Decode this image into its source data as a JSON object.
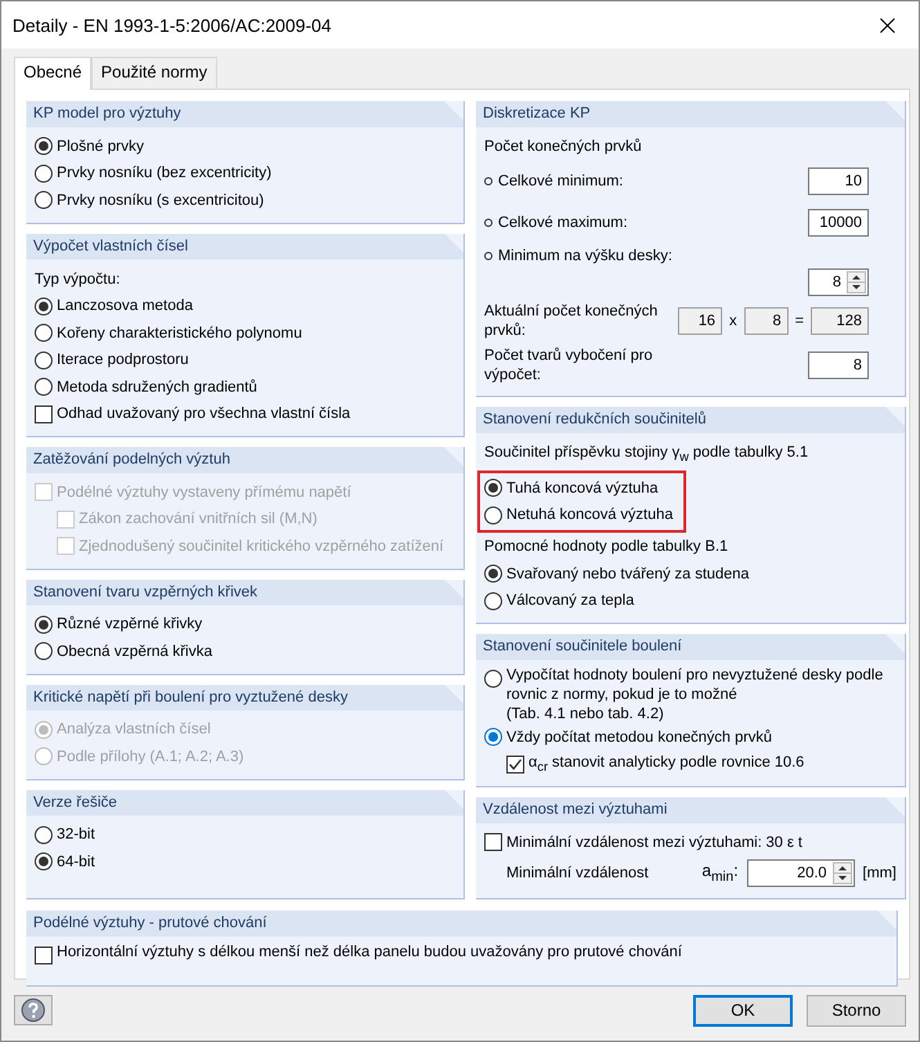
{
  "window": {
    "title": "Detaily - EN 1993-1-5:2006/AC:2009-04"
  },
  "tabs": [
    {
      "label": "Obecné",
      "selected": true
    },
    {
      "label": "Použité normy",
      "selected": false
    }
  ],
  "left_groups": [
    {
      "title": "KP model pro výztuhy",
      "items": [
        {
          "kind": "radio",
          "label": "Plošné prvky",
          "selected": true
        },
        {
          "kind": "radio",
          "label": "Prvky nosníku (bez excentricity)",
          "selected": false
        },
        {
          "kind": "radio",
          "label": "Prvky nosníku (s excentricitou)",
          "selected": false
        }
      ]
    },
    {
      "title": "Výpočet vlastních čísel",
      "items": [
        {
          "kind": "text",
          "label": "Typ výpočtu:"
        },
        {
          "kind": "radio",
          "label": "Lanczosova metoda",
          "selected": true
        },
        {
          "kind": "radio",
          "label": "Kořeny charakteristického polynomu",
          "selected": false
        },
        {
          "kind": "radio",
          "label": "Iterace podprostoru",
          "selected": false
        },
        {
          "kind": "radio",
          "label": "Metoda sdružených gradientů",
          "selected": false
        },
        {
          "kind": "checkbox",
          "label": "Odhad uvažovaný pro všechna vlastní čísla",
          "checked": false
        }
      ]
    },
    {
      "title": "Zatěžování podelných výztuh",
      "items": [
        {
          "kind": "checkbox",
          "label": "Podélné výztuhy vystaveny přímému napětí",
          "checked": false,
          "disabled": true,
          "children": [
            {
              "kind": "checkbox",
              "label": "Zákon zachování vnitřních sil (M,N)",
              "checked": false,
              "disabled": true
            },
            {
              "kind": "checkbox",
              "label": "Zjednodušený součinitel kritického vzpěrného zatížení",
              "checked": false,
              "disabled": true
            }
          ]
        }
      ]
    },
    {
      "title": "Stanovení tvaru vzpěrných křivek",
      "items": [
        {
          "kind": "radio",
          "label": "Různé vzpěrné křivky",
          "selected": true
        },
        {
          "kind": "radio",
          "label": "Obecná vzpěrná křivka",
          "selected": false
        }
      ]
    },
    {
      "title": "Kritické napětí při boulení pro vyztužené desky",
      "items": [
        {
          "kind": "radio",
          "label": "Analýza vlastních čísel",
          "selected": true,
          "disabled": true
        },
        {
          "kind": "radio",
          "label": "Podle přílohy (A.1; A.2; A.3)",
          "selected": false,
          "disabled": true
        }
      ]
    },
    {
      "title": "Verze řešiče",
      "items": [
        {
          "kind": "radio",
          "label": "32-bit",
          "selected": false
        },
        {
          "kind": "radio",
          "label": "64-bit",
          "selected": true
        }
      ]
    }
  ],
  "right_groups": [
    {
      "title": "Diskretizace KP",
      "items": [
        {
          "kind": "text",
          "label": "Počet konečných prvků"
        },
        {
          "kind": "field",
          "bullet": true,
          "label": "Celkové minimum:",
          "value": "10"
        },
        {
          "kind": "field",
          "bullet": true,
          "label": "Celkové maximum:",
          "value": "10000"
        },
        {
          "kind": "field",
          "bullet": true,
          "label": "Minimum na výšku desky:",
          "value": "8",
          "spinner": true
        },
        {
          "kind": "product",
          "label": "Aktuální počet konečných prvků:",
          "values": [
            "16",
            "8",
            "128"
          ],
          "operators": [
            "x",
            "="
          ]
        },
        {
          "kind": "field",
          "label": "Počet tvarů vybočení pro výpočet:",
          "value": "8"
        }
      ]
    },
    {
      "title": "Stanovení redukčních součinitelů",
      "items": [
        {
          "kind": "text",
          "label": "Součinitel příspěvku stojiny γ$_{w}$ podle tabulky 5.1"
        },
        {
          "kind": "highlight",
          "children": [
            {
              "kind": "radio",
              "label": "Tuhá koncová výztuha",
              "selected": true
            },
            {
              "kind": "radio",
              "label": "Netuhá koncová výztuha",
              "selected": false
            }
          ]
        },
        {
          "kind": "text",
          "label": "Pomocné hodnoty podle tabulky B.1"
        },
        {
          "kind": "radio",
          "label": "Svařovaný nebo tvářený za studena",
          "selected": true
        },
        {
          "kind": "radio",
          "label": "Válcovaný za tepla",
          "selected": false
        }
      ]
    },
    {
      "title": "Stanovení součinitele boulení",
      "items": [
        {
          "kind": "radio",
          "label": "Vypočítat hodnoty boulení pro nevyztužené desky podle rovnic z normy, pokud je to možné\n(Tab. 4.1 nebo tab. 4.2)",
          "selected": false
        },
        {
          "kind": "radio",
          "label": "Vždy počítat metodou konečných prvků",
          "selected": true,
          "focused": true,
          "children": [
            {
              "kind": "checkbox",
              "label": "α$_{cr}$ stanovit analyticky podle rovnice 10.6",
              "checked": true
            }
          ]
        }
      ]
    },
    {
      "title": "Vzdálenost mezi výztuhami",
      "items": [
        {
          "kind": "checkbox",
          "label": "Minimální vzdálenost mezi výztuhami: 30 ε t",
          "checked": false
        },
        {
          "kind": "dimension",
          "label": "Minimální vzdálenost",
          "symbol": "a$_{min}$:",
          "value": "20.0",
          "spinner": true,
          "unit": "[mm]"
        }
      ]
    }
  ],
  "bottom_group": {
    "title": "Podélné výztuhy - prutové chování",
    "items": [
      {
        "kind": "checkbox",
        "label": "Horizontální výztuhy s délkou menší než délka panelu budou uvažovány pro prutové chování",
        "checked": false
      }
    ]
  },
  "buttons": [
    {
      "label": "OK",
      "default": true
    },
    {
      "label": "Storno",
      "default": false
    }
  ]
}
